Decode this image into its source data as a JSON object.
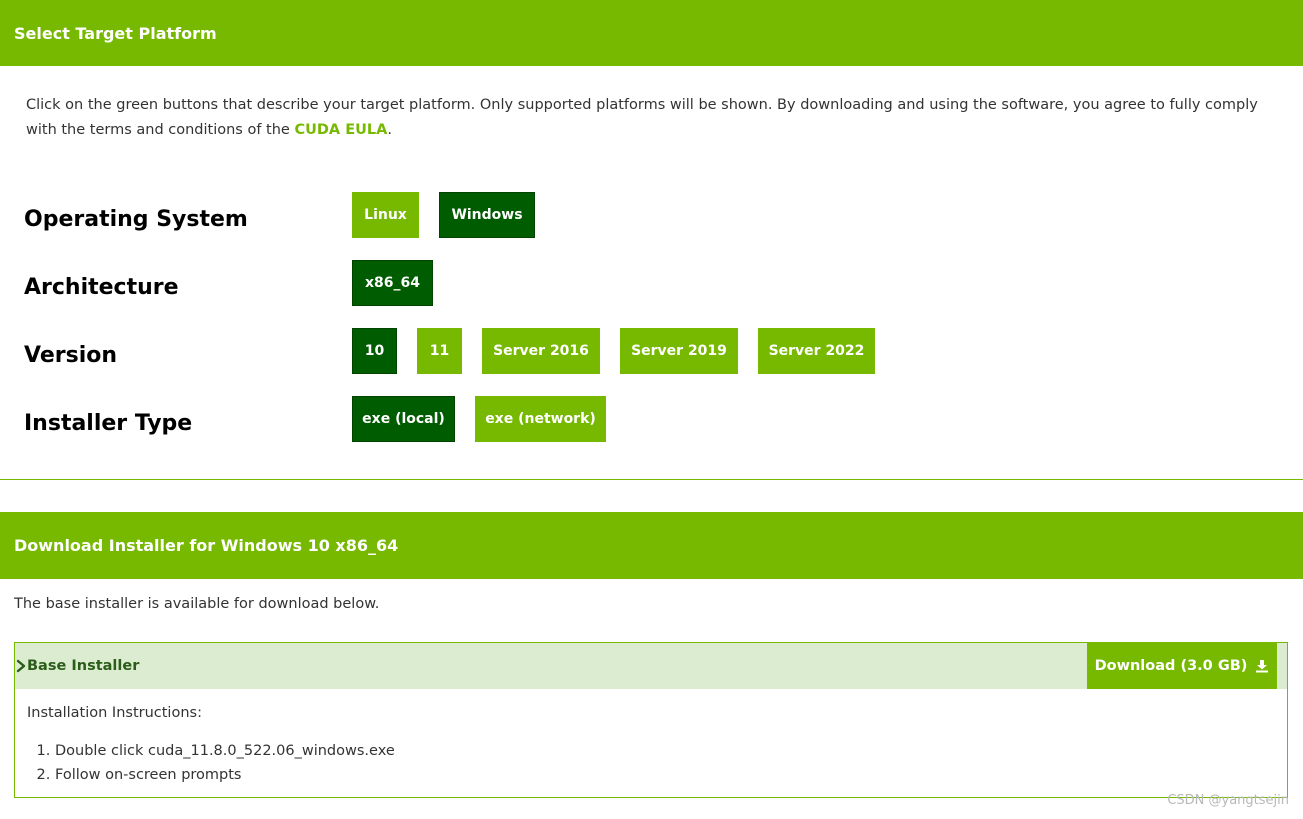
{
  "select_section": {
    "title": "Select Target Platform",
    "intro_text": "Click on the green buttons that describe your target platform. Only supported platforms will be shown. By downloading and using the software, you agree to fully comply with the terms and conditions of the ",
    "eula_link": "CUDA EULA",
    "intro_end": "."
  },
  "rows": {
    "os": {
      "label": "Operating System",
      "options": [
        "Linux",
        "Windows"
      ],
      "selected": "Windows"
    },
    "arch": {
      "label": "Architecture",
      "options": [
        "x86_64"
      ],
      "selected": "x86_64"
    },
    "version": {
      "label": "Version",
      "options": [
        "10",
        "11",
        "Server 2016",
        "Server 2019",
        "Server 2022"
      ],
      "selected": "10"
    },
    "installer": {
      "label": "Installer Type",
      "options": [
        "exe (local)",
        "exe (network)"
      ],
      "selected": "exe (local)"
    }
  },
  "download_section": {
    "title": "Download Installer for Windows 10 x86_64",
    "base_available": "The base installer is available for download below.",
    "installer_title": "Base Installer",
    "download_label": "Download (3.0 GB)",
    "instructions_title": "Installation Instructions:",
    "steps": [
      "Double click cuda_11.8.0_522.06_windows.exe",
      "Follow on-screen prompts"
    ]
  },
  "watermark": "CSDN @yangtsejin",
  "colors": {
    "brand_green": "#76b900",
    "selected_green": "#005c00",
    "installer_bar": "#dcecd0"
  }
}
